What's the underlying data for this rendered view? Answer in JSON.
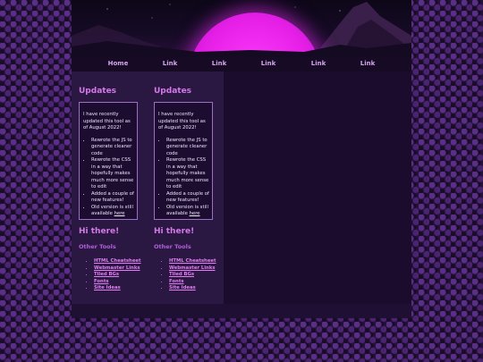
{
  "nav": {
    "items": [
      "Home",
      "Link",
      "Link",
      "Link",
      "Link",
      "Link"
    ]
  },
  "columns": [
    {
      "heading": "Updates",
      "intro": "I have recently updated this tool as of August 2022!",
      "bullets": [
        "Rewrote the JS to generate cleaner code",
        "Rewrote the CSS in a way that hopefully makes much more sense to edit",
        "Added a couple of new features!"
      ],
      "last_bullet_text": "Old version is still available ",
      "last_bullet_link": "here",
      "greeting": "Hi there!",
      "tools_heading": "Other Tools",
      "tools": [
        "HTML Cheatsheet",
        "Webmaster Links",
        "Tiled BGs",
        "Fonts",
        "Site Ideas"
      ]
    },
    {
      "heading": "Updates",
      "intro": "I have recently updated this tool as of August 2022!",
      "bullets": [
        "Rewrote the JS to generate cleaner code",
        "Rewrote the CSS in a way that hopefully makes much more sense to edit",
        "Added a couple of new features!"
      ],
      "last_bullet_text": "Old version is still available ",
      "last_bullet_link": "here",
      "greeting": "Hi there!",
      "tools_heading": "Other Tools",
      "tools": [
        "HTML Cheatsheet",
        "Webmaster Links",
        "Tiled BGs",
        "Fonts",
        "Site Ideas"
      ]
    }
  ],
  "colors": {
    "accent_heading": "#d37ae8",
    "link": "#e27df3",
    "sun": "#ff3cff"
  }
}
